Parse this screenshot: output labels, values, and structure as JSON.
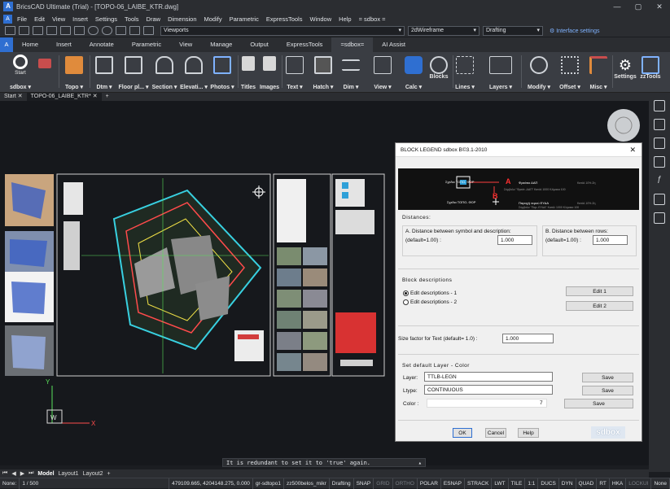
{
  "app": {
    "title": "BricsCAD Ultimate (Trial) - [TOPO-06_LAIBE_KTR.dwg]",
    "logo": "A"
  },
  "menu": [
    "File",
    "Edit",
    "View",
    "Insert",
    "Settings",
    "Tools",
    "Draw",
    "Dimension",
    "Modify",
    "Parametric",
    "ExpressTools",
    "Window",
    "Help",
    "=  sdbox  ="
  ],
  "toolbar": {
    "viewports": "Viewports",
    "visual_style": "2dWireframe",
    "workspace": "Drafting",
    "interface_settings": "Interface settings"
  },
  "ribbon_tabs": [
    "Home",
    "Insert",
    "Annotate",
    "Parametric",
    "View",
    "Manage",
    "Output",
    "ExpressTools",
    "=sdbox=",
    "AI Assist"
  ],
  "ribbon_active": "=sdbox=",
  "ribbon_groups": [
    {
      "label": "sdbox ▾",
      "sub": "Start"
    },
    {
      "label": "Topo ▾"
    },
    {
      "label": "Dtm ▾"
    },
    {
      "label": "Floor pl... ▾"
    },
    {
      "label": "Section ▾"
    },
    {
      "label": "Elevati... ▾"
    },
    {
      "label": "Photos ▾"
    },
    {
      "label": "Titles"
    },
    {
      "label": "Images"
    },
    {
      "label": "Text ▾"
    },
    {
      "label": "Hatch ▾"
    },
    {
      "label": "Dim ▾"
    },
    {
      "label": "View ▾"
    },
    {
      "label": "Calc ▾"
    },
    {
      "label": "Blocks"
    },
    {
      "label": "Lines ▾"
    },
    {
      "label": "Layers ▾"
    },
    {
      "label": "Modify ▾"
    },
    {
      "label": "Offset ▾"
    },
    {
      "label": "Misc ▾"
    },
    {
      "label": "Settings"
    },
    {
      "label": "zzTools"
    }
  ],
  "doc_tabs": [
    "Start",
    "TOPO-06_LAIBE_KTR*"
  ],
  "dialog": {
    "title": "BLOCK LEGEND     sdbox  B©3.1-2010",
    "preview": {
      "label_a": "A",
      "label_b": "B"
    },
    "distances_header": "Distances:",
    "dist_a_label": "A. Distance between symbol and description:",
    "dist_a_default": "(default=1.00) :",
    "dist_a_value": "1.000",
    "dist_b_label": "B. Distance between rows:",
    "dist_b_default": "(default=1.00) :",
    "dist_b_value": "1.000",
    "block_desc_header": "Block descriptions",
    "radio_1": "Edit descriptions - 1",
    "radio_2": "Edit descriptions - 2",
    "edit_1": "Edit 1",
    "edit_2": "Edit 2",
    "size_factor_label": "Size factor for Text (default= 1.0) :",
    "size_factor_value": "1.000",
    "layer_header": "Set default Layer - Color",
    "layer_label": "Layer:",
    "layer_value": "TTLB-LEGN",
    "ltype_label": "Ltype:",
    "ltype_value": "CONTINUOUS",
    "color_label": "Color :",
    "color_value": "7",
    "save": "Save",
    "ok": "OK",
    "cancel": "Cancel",
    "help": "Help",
    "brand": "sdbox"
  },
  "command_line": "It is redundant to set it to 'true' again.",
  "layout_tabs": [
    "Model",
    "Layout1",
    "Layout2"
  ],
  "status": {
    "none": "None:",
    "page": "1 / 500",
    "coords": "479109.665, 4204148.275, 0.000",
    "layer": "gr-sdtopo1",
    "scale": "zz500belos_mikr",
    "workspace": "Drafting",
    "toggles": [
      "SNAP",
      "GRID",
      "ORTHO",
      "POLAR",
      "ESNAP",
      "STRACK",
      "LWT",
      "TILE",
      "1:1",
      "DUCS",
      "DYN",
      "QUAD",
      "RT",
      "HKA",
      "LOCKUI",
      "None"
    ]
  },
  "colors": {
    "accent": "#2f6fd1",
    "bg": "#1b1d21",
    "panel": "#2b2d31"
  }
}
